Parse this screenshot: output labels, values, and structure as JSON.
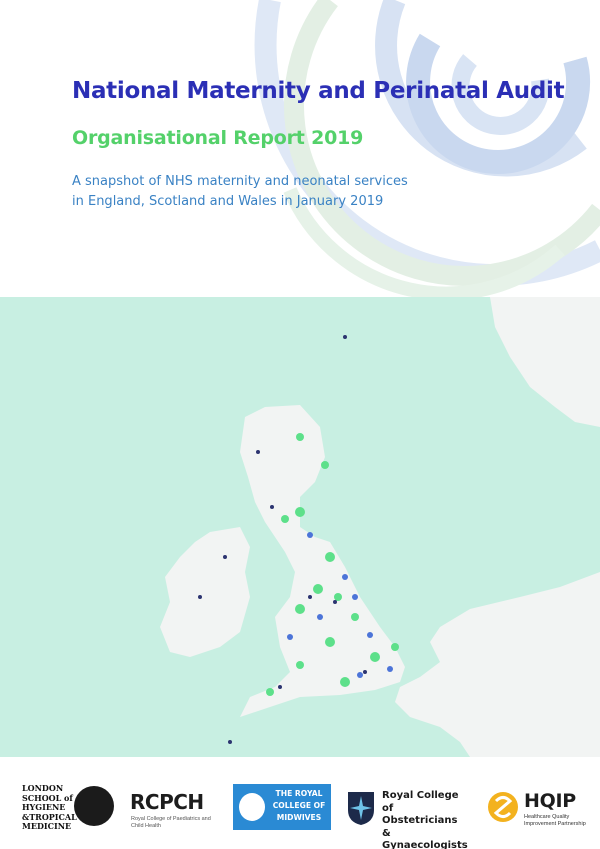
{
  "header": {
    "title": "National Maternity and Perinatal Audit",
    "subtitle": "Organisational Report 2019",
    "description_lines": [
      "A snapshot of NHS maternity and neonatal services",
      "in England, Scotland and Wales in January 2019"
    ]
  },
  "colors": {
    "title_blue": "#2b2fb5",
    "subtitle_green": "#54d16a",
    "description_blue": "#3a82c4",
    "sea": "#c8efe2",
    "land": "#f2f4f3",
    "dot_green": "#5de08a",
    "dot_blue": "#4c74d8",
    "dot_navy": "#2c3470"
  },
  "map": {
    "legend_note": "",
    "marker_colors": [
      "dot_green",
      "dot_blue",
      "dot_navy"
    ]
  },
  "logos": {
    "lshtm": {
      "lines": [
        "LONDON",
        "SCHOOL of",
        "HYGIENE",
        "&TROPICAL",
        "MEDICINE"
      ]
    },
    "rcpch": {
      "name": "RCPCH",
      "tagline": "Royal College of Paediatrics and Child Health"
    },
    "rcm": {
      "lines": [
        "THE ROYAL",
        "COLLEGE OF",
        "MIDWIVES"
      ]
    },
    "rcog": {
      "lines": [
        "Royal College of",
        "Obstetricians &",
        "Gynaecologists"
      ]
    },
    "hqip": {
      "name": "HQIP",
      "tagline": "Healthcare Quality Improvement Partnership"
    }
  }
}
